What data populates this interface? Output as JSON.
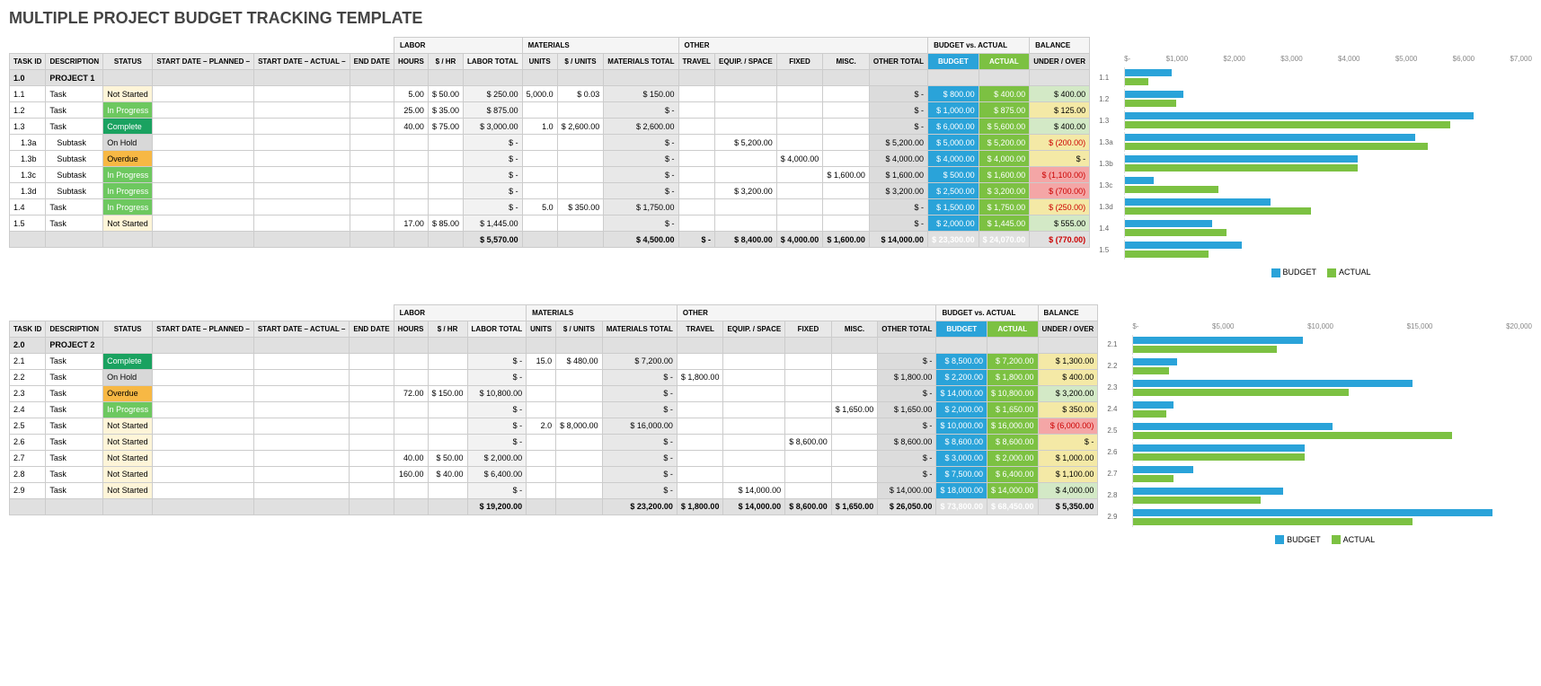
{
  "title": "MULTIPLE PROJECT BUDGET TRACKING TEMPLATE",
  "groupHeaders": {
    "labor": "LABOR",
    "materials": "MATERIALS",
    "other": "OTHER",
    "bva": "BUDGET vs. ACTUAL",
    "balance": "BALANCE"
  },
  "cols": {
    "taskid": "TASK ID",
    "desc": "DESCRIPTION",
    "status": "STATUS",
    "sdp": "START DATE – PLANNED –",
    "sda": "START DATE – ACTUAL –",
    "ed": "END DATE",
    "hours": "HOURS",
    "rate": "$ / HR",
    "labtot": "LABOR TOTAL",
    "units": "UNITS",
    "punit": "$ / UNITS",
    "mattot": "MATERIALS TOTAL",
    "travel": "TRAVEL",
    "equip": "EQUIP. / SPACE",
    "fixed": "FIXED",
    "misc": "MISC.",
    "othtot": "OTHER TOTAL",
    "budget": "BUDGET",
    "actual": "ACTUAL",
    "bal": "UNDER / OVER"
  },
  "legend": {
    "budget": "BUDGET",
    "actual": "ACTUAL"
  },
  "projects": [
    {
      "id": "1.0",
      "name": "PROJECT 1",
      "axisMax": 7000,
      "axisTicks": [
        "$-",
        "$1,000",
        "$2,000",
        "$3,000",
        "$4,000",
        "$5,000",
        "$6,000",
        "$7,000"
      ],
      "rows": [
        {
          "id": "1.1",
          "desc": "Task",
          "status": "Not Started",
          "st": "ns",
          "hours": "5.00",
          "rate": "$   50.00",
          "labtot": "$    250.00",
          "units": "5,000.0",
          "punit": "$    0.03",
          "mattot": "$    150.00",
          "othtot": "$         -",
          "budget": "$    800.00",
          "actual": "$    400.00",
          "bal": "$    400.00",
          "balc": "pos",
          "bv": 800,
          "av": 400
        },
        {
          "id": "1.2",
          "desc": "Task",
          "status": "In Progress",
          "st": "ip",
          "hours": "25.00",
          "rate": "$   35.00",
          "labtot": "$    875.00",
          "mattot": "$         -",
          "othtot": "$         -",
          "budget": "$ 1,000.00",
          "actual": "$    875.00",
          "bal": "$    125.00",
          "balc": "warn",
          "bv": 1000,
          "av": 875
        },
        {
          "id": "1.3",
          "desc": "Task",
          "status": "Complete",
          "st": "cp",
          "hours": "40.00",
          "rate": "$   75.00",
          "labtot": "$ 3,000.00",
          "units": "1.0",
          "punit": "$ 2,600.00",
          "mattot": "$ 2,600.00",
          "othtot": "$         -",
          "budget": "$ 6,000.00",
          "actual": "$ 5,600.00",
          "bal": "$    400.00",
          "balc": "pos",
          "bv": 6000,
          "av": 5600
        },
        {
          "id": "1.3a",
          "desc": "Subtask",
          "sub": true,
          "status": "On Hold",
          "st": "oh",
          "labtot": "$         -",
          "mattot": "$         -",
          "equip": "$ 5,200.00",
          "othtot": "$ 5,200.00",
          "budget": "$ 5,000.00",
          "actual": "$ 5,200.00",
          "bal": "$   (200.00)",
          "balc": "warn",
          "neg": true,
          "bv": 5000,
          "av": 5200
        },
        {
          "id": "1.3b",
          "desc": "Subtask",
          "sub": true,
          "status": "Overdue",
          "st": "od",
          "labtot": "$         -",
          "mattot": "$         -",
          "fixed": "$ 4,000.00",
          "othtot": "$ 4,000.00",
          "budget": "$ 4,000.00",
          "actual": "$ 4,000.00",
          "bal": "$         -",
          "balc": "zero",
          "bv": 4000,
          "av": 4000
        },
        {
          "id": "1.3c",
          "desc": "Subtask",
          "sub": true,
          "status": "In Progress",
          "st": "ip",
          "labtot": "$         -",
          "mattot": "$         -",
          "misc": "$ 1,600.00",
          "othtot": "$ 1,600.00",
          "budget": "$    500.00",
          "actual": "$ 1,600.00",
          "bal": "$ (1,100.00)",
          "balc": "neg",
          "neg": true,
          "bv": 500,
          "av": 1600
        },
        {
          "id": "1.3d",
          "desc": "Subtask",
          "sub": true,
          "status": "In Progress",
          "st": "ip",
          "labtot": "$         -",
          "mattot": "$         -",
          "equip": "$ 3,200.00",
          "othtot": "$ 3,200.00",
          "budget": "$ 2,500.00",
          "actual": "$ 3,200.00",
          "bal": "$   (700.00)",
          "balc": "neg",
          "neg": true,
          "bv": 2500,
          "av": 3200
        },
        {
          "id": "1.4",
          "desc": "Task",
          "status": "In Progress",
          "st": "ip",
          "labtot": "$         -",
          "units": "5.0",
          "punit": "$  350.00",
          "mattot": "$ 1,750.00",
          "othtot": "$         -",
          "budget": "$ 1,500.00",
          "actual": "$ 1,750.00",
          "bal": "$   (250.00)",
          "balc": "warn",
          "neg": true,
          "bv": 1500,
          "av": 1750
        },
        {
          "id": "1.5",
          "desc": "Task",
          "status": "Not Started",
          "st": "ns",
          "hours": "17.00",
          "rate": "$   85.00",
          "labtot": "$ 1,445.00",
          "mattot": "$         -",
          "othtot": "$         -",
          "budget": "$ 2,000.00",
          "actual": "$ 1,445.00",
          "bal": "$    555.00",
          "balc": "pos",
          "bv": 2000,
          "av": 1445
        }
      ],
      "totals": {
        "labtot": "$ 5,570.00",
        "mattot": "$ 4,500.00",
        "travel": "$         -",
        "equip": "$ 8,400.00",
        "fixed": "$ 4,000.00",
        "misc": "$ 1,600.00",
        "othtot": "$ 14,000.00",
        "budget": "$ 23,300.00",
        "actual": "$ 24,070.00",
        "bal": "$   (770.00)",
        "balc": "neg",
        "neg": true
      }
    },
    {
      "id": "2.0",
      "name": "PROJECT 2",
      "axisMax": 20000,
      "axisTicks": [
        "$-",
        "$5,000",
        "$10,000",
        "$15,000",
        "$20,000"
      ],
      "rows": [
        {
          "id": "2.1",
          "desc": "Task",
          "status": "Complete",
          "st": "cp",
          "labtot": "$         -",
          "units": "15.0",
          "punit": "$  480.00",
          "mattot": "$ 7,200.00",
          "othtot": "$         -",
          "budget": "$ 8,500.00",
          "actual": "$ 7,200.00",
          "bal": "$ 1,300.00",
          "balc": "warn",
          "bv": 8500,
          "av": 7200
        },
        {
          "id": "2.2",
          "desc": "Task",
          "status": "On Hold",
          "st": "oh",
          "labtot": "$         -",
          "mattot": "$         -",
          "travel": "$ 1,800.00",
          "othtot": "$ 1,800.00",
          "budget": "$ 2,200.00",
          "actual": "$ 1,800.00",
          "bal": "$    400.00",
          "balc": "warn",
          "bv": 2200,
          "av": 1800
        },
        {
          "id": "2.3",
          "desc": "Task",
          "status": "Overdue",
          "st": "od",
          "hours": "72.00",
          "rate": "$ 150.00",
          "labtot": "$ 10,800.00",
          "mattot": "$         -",
          "othtot": "$         -",
          "budget": "$ 14,000.00",
          "actual": "$ 10,800.00",
          "bal": "$ 3,200.00",
          "balc": "pos",
          "bv": 14000,
          "av": 10800
        },
        {
          "id": "2.4",
          "desc": "Task",
          "status": "In Progress",
          "st": "ip",
          "labtot": "$         -",
          "mattot": "$         -",
          "misc": "$ 1,650.00",
          "othtot": "$ 1,650.00",
          "budget": "$ 2,000.00",
          "actual": "$ 1,650.00",
          "bal": "$    350.00",
          "balc": "warn",
          "bv": 2000,
          "av": 1650
        },
        {
          "id": "2.5",
          "desc": "Task",
          "status": "Not Started",
          "st": "ns",
          "labtot": "$         -",
          "units": "2.0",
          "punit": "$ 8,000.00",
          "mattot": "$ 16,000.00",
          "othtot": "$         -",
          "budget": "$ 10,000.00",
          "actual": "$ 16,000.00",
          "bal": "$ (6,000.00)",
          "balc": "neg",
          "neg": true,
          "bv": 10000,
          "av": 16000
        },
        {
          "id": "2.6",
          "desc": "Task",
          "status": "Not Started",
          "st": "ns",
          "labtot": "$         -",
          "mattot": "$         -",
          "fixed": "$ 8,600.00",
          "othtot": "$ 8,600.00",
          "budget": "$ 8,600.00",
          "actual": "$ 8,600.00",
          "bal": "$         -",
          "balc": "zero",
          "bv": 8600,
          "av": 8600
        },
        {
          "id": "2.7",
          "desc": "Task",
          "status": "Not Started",
          "st": "ns",
          "hours": "40.00",
          "rate": "$   50.00",
          "labtot": "$ 2,000.00",
          "mattot": "$         -",
          "othtot": "$         -",
          "budget": "$ 3,000.00",
          "actual": "$ 2,000.00",
          "bal": "$ 1,000.00",
          "balc": "warn",
          "bv": 3000,
          "av": 2000
        },
        {
          "id": "2.8",
          "desc": "Task",
          "status": "Not Started",
          "st": "ns",
          "hours": "160.00",
          "rate": "$   40.00",
          "labtot": "$ 6,400.00",
          "mattot": "$         -",
          "othtot": "$         -",
          "budget": "$ 7,500.00",
          "actual": "$ 6,400.00",
          "bal": "$ 1,100.00",
          "balc": "warn",
          "bv": 7500,
          "av": 6400
        },
        {
          "id": "2.9",
          "desc": "Task",
          "status": "Not Started",
          "st": "ns",
          "labtot": "$         -",
          "mattot": "$         -",
          "equip": "$ 14,000.00",
          "othtot": "$ 14,000.00",
          "budget": "$ 18,000.00",
          "actual": "$ 14,000.00",
          "bal": "$ 4,000.00",
          "balc": "pos",
          "bv": 18000,
          "av": 14000
        }
      ],
      "totals": {
        "labtot": "$ 19,200.00",
        "mattot": "$ 23,200.00",
        "travel": "$ 1,800.00",
        "equip": "$ 14,000.00",
        "fixed": "$ 8,600.00",
        "misc": "$ 1,650.00",
        "othtot": "$ 26,050.00",
        "budget": "$ 73,800.00",
        "actual": "$ 68,450.00",
        "bal": "$ 5,350.00",
        "balc": "pos"
      }
    }
  ],
  "chart_data": [
    {
      "type": "bar",
      "title": "",
      "xlabel": "",
      "ylabel": "",
      "ylim": [
        0,
        7000
      ],
      "categories": [
        "1.1",
        "1.2",
        "1.3",
        "1.3a",
        "1.3b",
        "1.3c",
        "1.3d",
        "1.4",
        "1.5"
      ],
      "series": [
        {
          "name": "BUDGET",
          "values": [
            800,
            1000,
            6000,
            5000,
            4000,
            500,
            2500,
            1500,
            2000
          ]
        },
        {
          "name": "ACTUAL",
          "values": [
            400,
            875,
            5600,
            5200,
            4000,
            1600,
            3200,
            1750,
            1445
          ]
        }
      ]
    },
    {
      "type": "bar",
      "title": "",
      "xlabel": "",
      "ylabel": "",
      "ylim": [
        0,
        20000
      ],
      "categories": [
        "2.1",
        "2.2",
        "2.3",
        "2.4",
        "2.5",
        "2.6",
        "2.7",
        "2.8",
        "2.9"
      ],
      "series": [
        {
          "name": "BUDGET",
          "values": [
            8500,
            2200,
            14000,
            2000,
            10000,
            8600,
            3000,
            7500,
            18000
          ]
        },
        {
          "name": "ACTUAL",
          "values": [
            7200,
            1800,
            10800,
            1650,
            16000,
            8600,
            2000,
            6400,
            14000
          ]
        }
      ]
    }
  ]
}
